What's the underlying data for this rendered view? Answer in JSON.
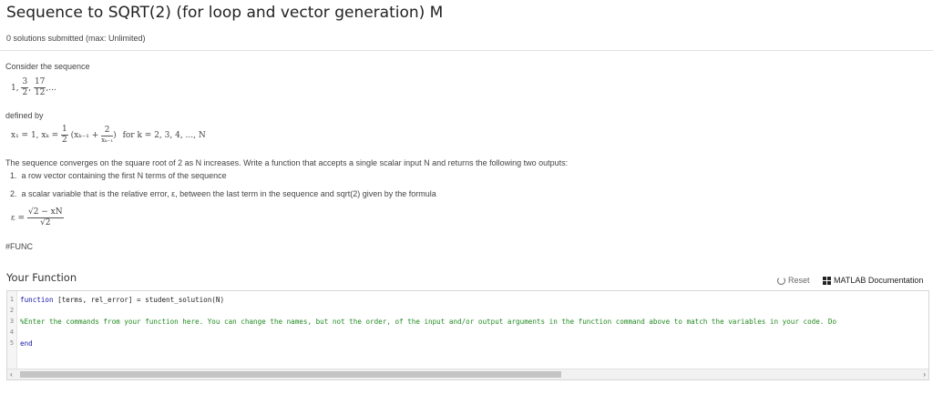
{
  "problem": {
    "title": "Sequence to SQRT(2) (for loop and vector generation) M",
    "submissions": "0 solutions submitted (max: Unlimited)"
  },
  "description": {
    "consider": "Consider the sequence",
    "defined_by": "defined by",
    "converges": "The sequence converges on the square root of 2 as N increases. Write a function that accepts a single scalar input N and returns the following two outputs:",
    "outputs": [
      {
        "num": "1.",
        "text": "a row vector containing the first N terms of the sequence"
      },
      {
        "num": "2.",
        "text": "a scalar variable that is the relative error, ε, between the last term in the sequence and sqrt(2) given by the formula"
      }
    ],
    "tag": "#FUNC"
  },
  "math": {
    "seq_first": "1,",
    "seq_num1": "3",
    "seq_den1": "2",
    "seq_num2": "17",
    "seq_den2": "12",
    "seq_tail": ",...",
    "rec_lhs": "x₁ = 1, xₖ =",
    "rec_num_half": "1",
    "rec_den_half": "2",
    "rec_paren_open": "(xₖ₋₁ +",
    "rec_num_two": "2",
    "rec_den_x": "xₖ₋₁",
    "rec_paren_close": ")",
    "rec_for": "for k = 2, 3, 4, ..., N",
    "err_lhs": "ε =",
    "err_num": "√2 − xN",
    "err_den": "√2"
  },
  "your_function": {
    "heading": "Your Function",
    "reset_label": "Reset",
    "docs_label": "MATLAB Documentation"
  },
  "editor": {
    "line_numbers": [
      "1",
      "2",
      "3",
      "4",
      "5"
    ],
    "line1_kw": "function",
    "line1_rest": " [terms, rel_error] = student_solution(N)",
    "line3_comment": "%Enter the commands from your function here.  You can change the names, but not the order, of the input and/or output arguments in the function command above to match the variables in your code.  Do",
    "line5_kw": "end",
    "scroll_left": "‹",
    "scroll_right": "›"
  }
}
